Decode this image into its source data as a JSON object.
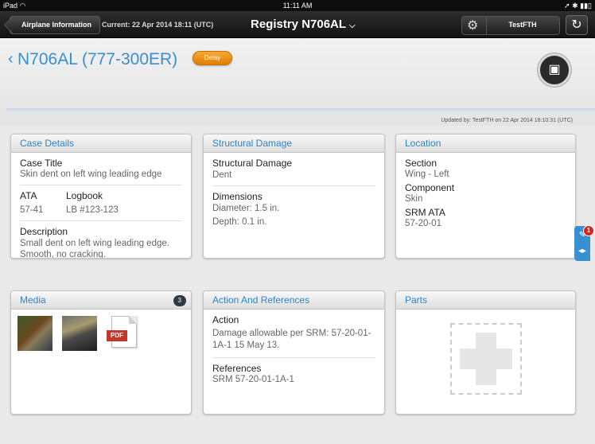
{
  "status_bar": {
    "time": "11:11 AM",
    "wifi_icon": "wifi-icon",
    "battery_icon": "battery-icon"
  },
  "nav": {
    "back_label": "Airplane Information",
    "current": "Current: 22 Apr 2014 18:11 (UTC)",
    "title": "Registry N706AL",
    "user": "TestFTH"
  },
  "header": {
    "case_title": "N706AL (777-300ER)",
    "status_badge": "Delay",
    "updated_text": "Updated by:  TestFTH  on  22 Apr 2014 18:10:31 (UTC)"
  },
  "case_details": {
    "title": "Case Details",
    "case_title_label": "Case Title",
    "case_title_value": "Skin dent on left wing leading edge",
    "ata_label": "ATA",
    "ata_value": "57-41",
    "logbook_label": "Logbook",
    "logbook_value": "LB #123-123",
    "description_label": "Description",
    "description_value": "Small dent on left wing leading edge. Smooth, no cracking."
  },
  "structural_damage": {
    "title": "Structural Damage",
    "type_label": "Structural Damage",
    "type_value": "Dent",
    "dimensions_label": "Dimensions",
    "diameter": "Diameter: 1.5 in.",
    "depth": "Depth: 0.1 in."
  },
  "location": {
    "title": "Location",
    "section_label": "Section",
    "section_value": "Wing - Left",
    "component_label": "Component",
    "component_value": "Skin",
    "srm_label": "SRM ATA",
    "srm_value": "57-20-01"
  },
  "media": {
    "title": "Media",
    "count": "3",
    "pdf_label": "PDF"
  },
  "action": {
    "title": "Action And References",
    "action_label": "Action",
    "action_value": "Damage allowable per  SRM: 57-20-01-1A-1 15 May 13.",
    "references_label": "References",
    "references_value": "SRM 57-20-01-1A-1"
  },
  "parts": {
    "title": "Parts"
  },
  "side_tab": {
    "notification_count": "1"
  }
}
